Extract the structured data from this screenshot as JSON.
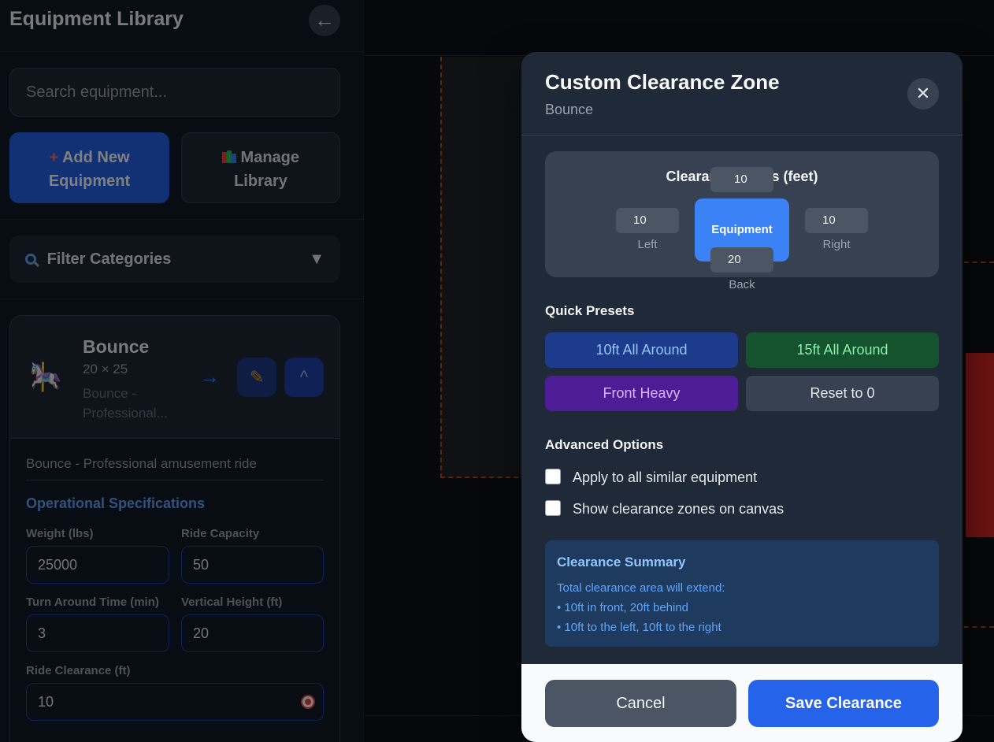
{
  "sidebar": {
    "title": "Equipment Library",
    "back_icon": "←",
    "search_placeholder": "Search equipment...",
    "add_button": {
      "line1": "Add New",
      "line2": "Equipment"
    },
    "manage_button": {
      "line1": "Manage",
      "line2": "Library"
    },
    "filter_label": "Filter Categories",
    "filter_caret": "▼",
    "card": {
      "name": "Bounce",
      "dimensions": "20 × 25",
      "short_desc": "Bounce - Professional...",
      "full_desc": "Bounce - Professional amusement ride",
      "arrow": "→",
      "edit_icon": "✎",
      "collapse_icon": "^",
      "section_title": "Operational Specifications",
      "fields": {
        "weight": {
          "label": "Weight (lbs)",
          "value": "25000"
        },
        "capacity": {
          "label": "Ride Capacity",
          "value": "50"
        },
        "turnaround": {
          "label": "Turn Around Time (min)",
          "value": "3"
        },
        "height": {
          "label": "Vertical Height (ft)",
          "value": "20"
        },
        "clearance": {
          "label": "Ride Clearance (ft)",
          "value": "10"
        }
      }
    }
  },
  "modal": {
    "title": "Custom Clearance Zone",
    "subtitle": "Bounce",
    "close_icon": "✕",
    "diagram": {
      "title": "Clearance Zones (feet)",
      "equipment_label": "Equipment",
      "front": "10",
      "left": "10",
      "right": "10",
      "back": "20",
      "left_label": "Left",
      "right_label": "Right",
      "back_label": "Back"
    },
    "presets_title": "Quick Presets",
    "presets": [
      "10ft All Around",
      "15ft All Around",
      "Front Heavy",
      "Reset to 0"
    ],
    "advanced_title": "Advanced Options",
    "options": [
      "Apply to all similar equipment",
      "Show clearance zones on canvas"
    ],
    "summary": {
      "title": "Clearance Summary",
      "intro": "Total clearance area will extend:",
      "line1": "• 10ft in front, 20ft behind",
      "line2": "• 10ft to the left, 10ft to the right"
    },
    "cancel_label": "Cancel",
    "save_label": "Save Clearance"
  },
  "colors": {
    "accent": "#2563eb",
    "equipment": "#3b82f6",
    "preset_blue_bg": "#1e3a8a",
    "preset_green_bg": "#14532d",
    "preset_purple_bg": "#4c1d95",
    "zone_border": "#b45309"
  }
}
